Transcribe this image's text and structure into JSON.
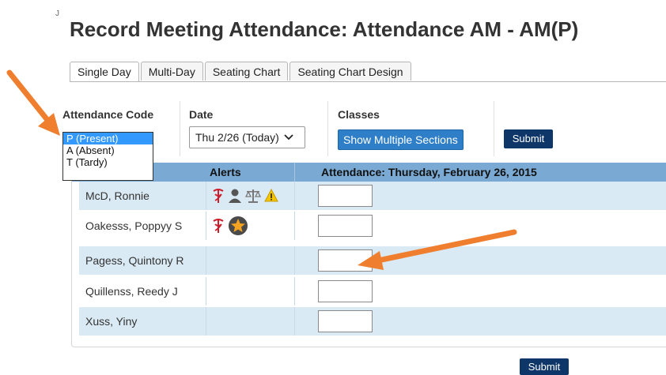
{
  "page": {
    "title": "Record Meeting Attendance: Attendance AM - AM(P)",
    "corner_mark": "J"
  },
  "tabs": [
    {
      "label": "Single Day",
      "active": true
    },
    {
      "label": "Multi-Day",
      "active": false
    },
    {
      "label": "Seating Chart",
      "active": false
    },
    {
      "label": "Seating Chart Design",
      "active": false
    }
  ],
  "filters": {
    "attendance_code_label": "Attendance Code",
    "date_label": "Date",
    "date_value": "Thu 2/26 (Today)",
    "classes_label": "Classes",
    "show_multiple_label": "Show Multiple Sections",
    "submit_label": "Submit"
  },
  "attendance_codes": [
    {
      "label": "P (Present)",
      "selected": true
    },
    {
      "label": "A (Absent)",
      "selected": false
    },
    {
      "label": "T (Tardy)",
      "selected": false
    }
  ],
  "table": {
    "headers": {
      "alerts": "Alerts",
      "attendance": "Attendance: Thursday, February 26, 2015"
    },
    "rows": [
      {
        "name": "McD, Ronnie",
        "alerts": [
          "medical-alert-icon",
          "guardian-alert-icon",
          "legal-alert-icon",
          "warning-icon"
        ]
      },
      {
        "name": "Oakesss, Poppyy S",
        "alerts": [
          "medical-alert-icon",
          "star-badge-icon"
        ]
      },
      {
        "name": "Pagess, Quintony R",
        "alerts": []
      },
      {
        "name": "Quillenss, Reedy J",
        "alerts": []
      },
      {
        "name": "Xuss, Yiny",
        "alerts": []
      }
    ]
  },
  "footer": {
    "submit_label": "Submit"
  },
  "colors": {
    "header_bg": "#7aa9d3",
    "row_alt_bg": "#daeaf4",
    "submit_bg": "#0e3668",
    "show_multiple_bg": "#2f7fc8",
    "annotation_arrow": "#ef7f2e",
    "medical_red": "#cc1f2d"
  }
}
